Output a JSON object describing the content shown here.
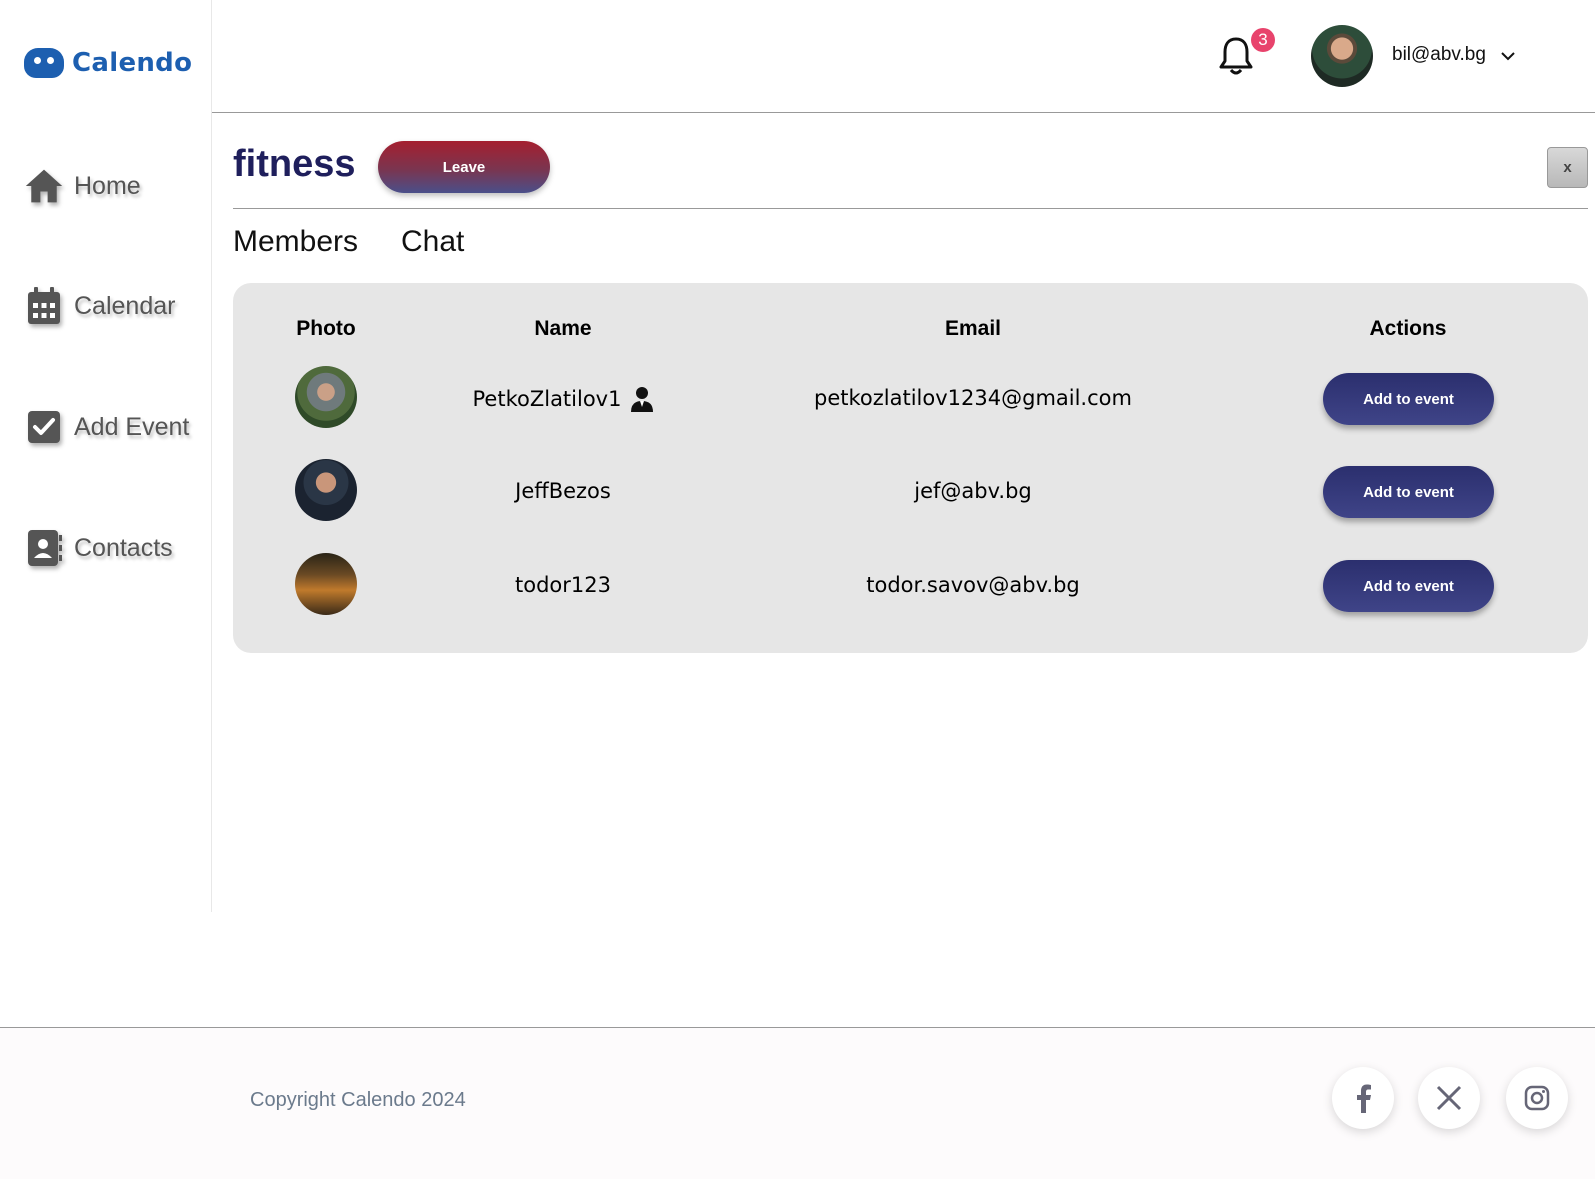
{
  "app": {
    "logo_text": "Calendo"
  },
  "sidebar": {
    "items": [
      {
        "label": "Home",
        "icon": "home-icon"
      },
      {
        "label": "Calendar",
        "icon": "calendar-icon"
      },
      {
        "label": "Add Event",
        "icon": "check-square-icon"
      },
      {
        "label": "Contacts",
        "icon": "contact-book-icon"
      }
    ]
  },
  "header": {
    "notification_count": "3",
    "user_email": "bil@abv.bg"
  },
  "group": {
    "title": "fitness",
    "leave_label": "Leave",
    "close_label": "x"
  },
  "tabs": [
    {
      "label": "Members"
    },
    {
      "label": "Chat"
    }
  ],
  "members_table": {
    "columns": [
      "Photo",
      "Name",
      "Email",
      "Actions"
    ],
    "rows": [
      {
        "name": "PetkoZlatilov1",
        "email": "petkozlatilov1234@gmail.com",
        "action": "Add to event",
        "is_admin": true
      },
      {
        "name": "JeffBezos",
        "email": "jef@abv.bg",
        "action": "Add to event",
        "is_admin": false
      },
      {
        "name": "todor123",
        "email": "todor.savov@abv.bg",
        "action": "Add to event",
        "is_admin": false
      }
    ]
  },
  "footer": {
    "copyright": "Copyright Calendo 2024",
    "social": [
      "facebook-icon",
      "x-icon",
      "instagram-icon"
    ]
  },
  "colors": {
    "brand": "#1d5fb0",
    "title": "#1f1f5c",
    "badge": "#e8436c",
    "button": "#2b2f6e",
    "leave_top": "#a51f2f"
  }
}
